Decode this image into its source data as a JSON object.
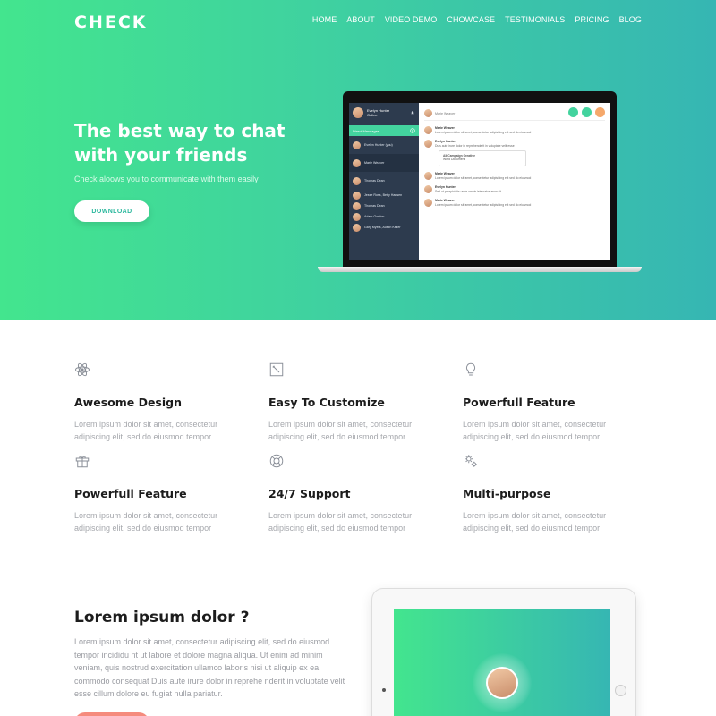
{
  "brand": {
    "logo": "CHECK"
  },
  "nav": {
    "items": [
      "HOME",
      "ABOUT",
      "VIDEO DEMO",
      "CHOWCASE",
      "TESTIMONIALS",
      "PRICING",
      "BLOG"
    ]
  },
  "hero": {
    "title": "The best way to chat with your friends",
    "subtitle": "Check aloows you to communicate with them easily",
    "download_label": "DOWNLOAD"
  },
  "app_preview": {
    "user_name": "Evelyn Hunter",
    "user_status": "Online",
    "direct_messages_label": "Direct Messages",
    "contacts": [
      "Evelyn Hunter (you)",
      "Marie Weaver",
      "Thomas Dean",
      "Jesse Ross, Betty Hansen",
      "Thomas Dean",
      "Adam Gordon",
      "Gary Myers, Austin Keller"
    ],
    "header_contact": "Marie Weaver",
    "messages": [
      {
        "name": "Marie Weaver",
        "text": "Lorem ipsum dolor sit amet, consectetur adipisicing elit sed do eiusmod"
      },
      {
        "name": "Evelyn Hunter",
        "text": "Duis aute irure dolor in reprehenderit in voluptate velit esse"
      },
      {
        "name": "Marie Weaver",
        "text": "Lorem ipsum dolor sit amet, consectetur adipisicing elit sed do eiusmod"
      },
      {
        "name": "Evelyn Hunter",
        "text": "Sed ut perspiciatis unde omnis iste natus error sit"
      },
      {
        "name": "Marie Weaver",
        "text": "Lorem ipsum dolor sit amet, consectetur adipisicing elit sed do eiusmod"
      }
    ],
    "file_name": "All Campaign Creative",
    "file_type": "Word Document"
  },
  "features": [
    {
      "icon": "atom-icon",
      "title": "Awesome Design",
      "text": "Lorem ipsum dolor sit amet, consectetur adipiscing elit, sed do eiusmod tempor"
    },
    {
      "icon": "edit-square-icon",
      "title": "Easy To Customize",
      "text": "Lorem ipsum dolor sit amet, consectetur adipiscing elit, sed do eiusmod tempor"
    },
    {
      "icon": "lightbulb-icon",
      "title": "Powerfull Feature",
      "text": "Lorem ipsum dolor sit amet, consectetur adipiscing elit, sed do eiusmod tempor"
    },
    {
      "icon": "gift-icon",
      "title": "Powerfull Feature",
      "text": "Lorem ipsum dolor sit amet, consectetur adipiscing elit, sed do eiusmod tempor"
    },
    {
      "icon": "lifebuoy-icon",
      "title": "24/7 Support",
      "text": "Lorem ipsum dolor sit amet, consectetur adipiscing elit, sed do eiusmod tempor"
    },
    {
      "icon": "gears-icon",
      "title": "Multi-purpose",
      "text": "Lorem ipsum dolor sit amet, consectetur adipiscing elit, sed do eiusmod tempor"
    }
  ],
  "about": {
    "title": "Lorem ipsum dolor ?",
    "text": "Lorem ipsum dolor sit amet, consectetur adipiscing elit, sed do eiusmod tempor incididu nt ut labore et dolore magna aliqua. Ut enim ad minim veniam, quis nostrud exercitation ullamco laboris nisi ut aliquip ex ea commodo consequat Duis aute irure dolor in reprehe nderit in voluptate velit esse cillum dolore eu fugiat nulla pariatur."
  },
  "colors": {
    "gradient_start": "#43e58e",
    "gradient_end": "#36b6b3",
    "accent": "#f58b7d"
  }
}
